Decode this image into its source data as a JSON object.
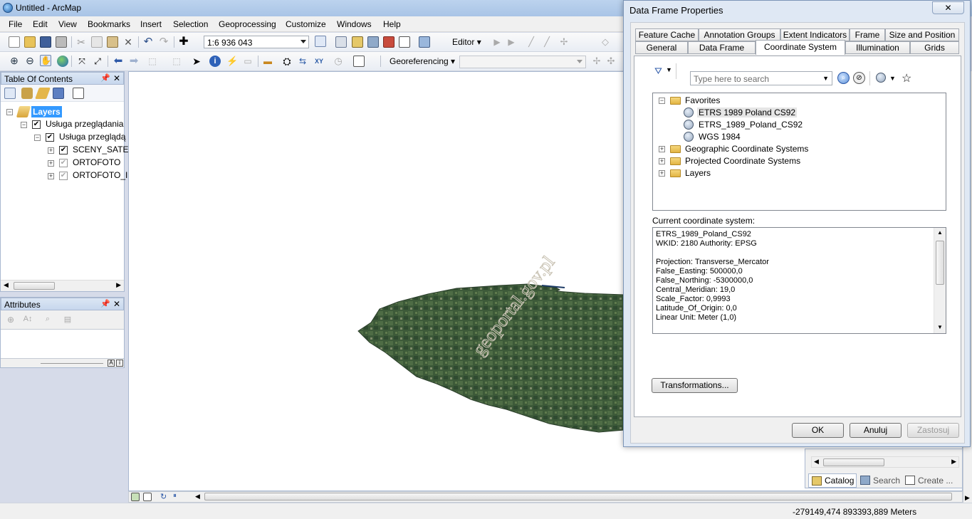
{
  "app": {
    "title": "Untitled - ArcMap"
  },
  "menu": [
    "File",
    "Edit",
    "View",
    "Bookmarks",
    "Insert",
    "Selection",
    "Geoprocessing",
    "Customize",
    "Windows",
    "Help"
  ],
  "toolbar": {
    "scale": "1:6 936 043",
    "editor_label": "Editor",
    "georef_label": "Georeferencing"
  },
  "toc": {
    "title": "Table Of Contents",
    "layers_label": "Layers",
    "items": [
      {
        "label": "Usługa przeglądania",
        "checked": true
      },
      {
        "label": "Usługa przeglądą",
        "checked": true
      },
      {
        "label": "SCENY_SATEI",
        "checked": true
      },
      {
        "label": "ORTOFOTO",
        "checked": false
      },
      {
        "label": "ORTOFOTO_I",
        "checked": false
      }
    ]
  },
  "attributes": {
    "title": "Attributes"
  },
  "map": {
    "watermark": "geoportal.gov.pl"
  },
  "dock_tabs": {
    "catalog": "Catalog",
    "search": "Search",
    "create": "Create ..."
  },
  "status": {
    "coords": "-279149,474  893393,889 Meters"
  },
  "dialog": {
    "title": "Data Frame Properties",
    "close_glyph": "✕",
    "tabs_row1": [
      "Feature Cache",
      "Annotation Groups",
      "Extent Indicators",
      "Frame",
      "Size and Position"
    ],
    "tabs_row2": [
      "General",
      "Data Frame",
      "Coordinate System",
      "Illumination",
      "Grids"
    ],
    "active_tab": "Coordinate System",
    "search_placeholder": "Type here to search",
    "tree": {
      "favorites": "Favorites",
      "favorites_items": [
        "ETRS 1989 Poland CS92",
        "ETRS_1989_Poland_CS92",
        "WGS 1984"
      ],
      "folders": [
        "Geographic Coordinate Systems",
        "Projected Coordinate Systems",
        "Layers"
      ]
    },
    "current_label": "Current coordinate system:",
    "current_lines": [
      "ETRS_1989_Poland_CS92",
      "WKID: 2180 Authority: EPSG",
      "",
      "Projection: Transverse_Mercator",
      "False_Easting: 500000,0",
      "False_Northing: -5300000,0",
      "Central_Meridian: 19,0",
      "Scale_Factor: 0,9993",
      "Latitude_Of_Origin: 0,0",
      "Linear Unit: Meter (1,0)"
    ],
    "transformations_button": "Transformations...",
    "ok_button": "OK",
    "cancel_button": "Anuluj",
    "apply_button": "Zastosuj"
  }
}
